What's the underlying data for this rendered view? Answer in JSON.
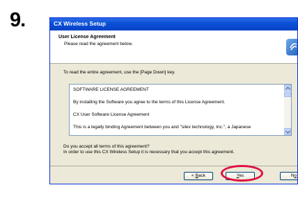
{
  "step_number": "9.",
  "window": {
    "title": "CX Wireless Setup"
  },
  "header": {
    "title": "User License Agreement",
    "subtitle": "Please read the agreement below."
  },
  "instructions": "To read the entire agreement, use the [Page Down] key.",
  "agreement_lines": [
    "SOFTWARE LICENSE AGREEMENT",
    "By installing the Software you agree to the terms of this License Agreement.",
    "CX User Software License Agreement",
    "This is a legally binding Agreement between you and \"silex technology, Inc.\", a Japanese"
  ],
  "question": {
    "line1": "Do you accept all terms of this agreement?",
    "line2": "In order to use this CX Wireless Setup it is necessary that you accept this agreement."
  },
  "buttons": {
    "back_prefix": "< ",
    "back_mnemonic": "B",
    "back_rest": "ack",
    "yes_mnemonic": "Y",
    "yes_rest": "es",
    "no_prefix": "N",
    "no_mnemonic": "o"
  },
  "colors": {
    "titlebar": "#0a4fd6",
    "highlight_ring": "#e01040",
    "dialog_bg": "#ece9d8"
  }
}
